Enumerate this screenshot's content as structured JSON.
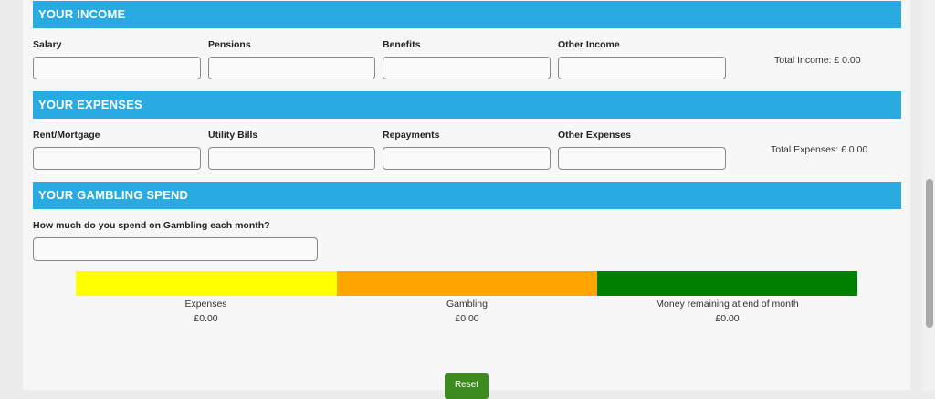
{
  "income": {
    "heading": "YOUR INCOME",
    "fields": [
      {
        "label": "Salary",
        "value": ""
      },
      {
        "label": "Pensions",
        "value": ""
      },
      {
        "label": "Benefits",
        "value": ""
      },
      {
        "label": "Other Income",
        "value": ""
      }
    ],
    "total": "Total Income: £ 0.00"
  },
  "expenses": {
    "heading": "YOUR EXPENSES",
    "fields": [
      {
        "label": "Rent/Mortgage",
        "value": ""
      },
      {
        "label": "Utility Bills",
        "value": ""
      },
      {
        "label": "Repayments",
        "value": ""
      },
      {
        "label": "Other Expenses",
        "value": ""
      }
    ],
    "total": "Total Expenses: £ 0.00"
  },
  "gambling": {
    "heading": "YOUR GAMBLING SPEND",
    "question": "How much do you spend on Gambling each month?",
    "value": ""
  },
  "breakdown": {
    "segments": [
      {
        "label": "Expenses",
        "amount": "£0.00",
        "color": "#ffff00"
      },
      {
        "label": "Gambling",
        "amount": "£0.00",
        "color": "#ffa500"
      },
      {
        "label": "Money remaining at end of month",
        "amount": "£0.00",
        "color": "#008000"
      }
    ]
  },
  "reset_label": "Reset",
  "colors": {
    "section_bar": "#29abe2",
    "reset_button": "#3d8b1e"
  }
}
